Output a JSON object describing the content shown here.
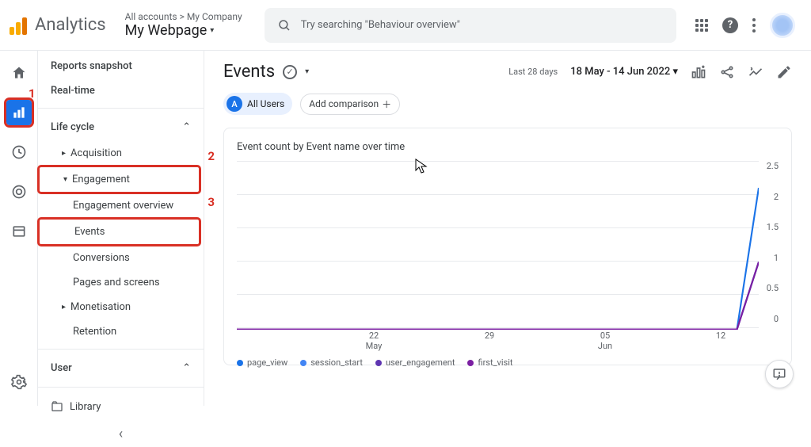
{
  "brand": "Analytics",
  "breadcrumb": "All accounts > My Company",
  "property": "My Webpage",
  "search": {
    "placeholder": "Try searching \"Behaviour overview\""
  },
  "sidebar": {
    "snapshot": "Reports snapshot",
    "realtime": "Real-time",
    "lifecycle": "Life cycle",
    "acquisition": "Acquisition",
    "engagement": "Engagement",
    "engagement_overview": "Engagement overview",
    "events": "Events",
    "conversions": "Conversions",
    "pages": "Pages and screens",
    "monetisation": "Monetisation",
    "retention": "Retention",
    "user": "User",
    "library": "Library"
  },
  "page": {
    "title": "Events",
    "date_label": "Last 28 days",
    "date_range": "18 May - 14 Jun 2022",
    "all_users": "All Users",
    "add_comparison": "Add comparison"
  },
  "chart_data": {
    "type": "line",
    "title": "Event count by Event name over time",
    "xlabel": "",
    "ylabel": "",
    "ylim": [
      0,
      2.5
    ],
    "y_ticks": [
      "2.5",
      "2",
      "1.5",
      "1",
      "0.5",
      "0"
    ],
    "x_ticks": [
      {
        "line1": "22",
        "line2": "May"
      },
      {
        "line1": "29",
        "line2": ""
      },
      {
        "line1": "05",
        "line2": "Jun"
      },
      {
        "line1": "12",
        "line2": ""
      }
    ],
    "series": [
      {
        "name": "page_view",
        "color": "#1a73e8",
        "values": [
          0,
          0,
          0,
          0,
          0,
          0,
          0,
          0,
          0,
          0,
          0,
          0,
          0,
          0,
          0,
          0,
          0,
          0,
          0,
          0,
          0,
          0,
          0,
          0,
          2.1
        ]
      },
      {
        "name": "session_start",
        "color": "#4285f4",
        "values": [
          0,
          0,
          0,
          0,
          0,
          0,
          0,
          0,
          0,
          0,
          0,
          0,
          0,
          0,
          0,
          0,
          0,
          0,
          0,
          0,
          0,
          0,
          0,
          0,
          1.0
        ]
      },
      {
        "name": "user_engagement",
        "color": "#5e35b1",
        "values": [
          0,
          0,
          0,
          0,
          0,
          0,
          0,
          0,
          0,
          0,
          0,
          0,
          0,
          0,
          0,
          0,
          0,
          0,
          0,
          0,
          0,
          0,
          0,
          0,
          1.0
        ]
      },
      {
        "name": "first_visit",
        "color": "#7b1fa2",
        "values": [
          0,
          0,
          0,
          0,
          0,
          0,
          0,
          0,
          0,
          0,
          0,
          0,
          0,
          0,
          0,
          0,
          0,
          0,
          0,
          0,
          0,
          0,
          0,
          0,
          1.0
        ]
      }
    ]
  },
  "annotations": {
    "a1": "1",
    "a2": "2",
    "a3": "3"
  }
}
